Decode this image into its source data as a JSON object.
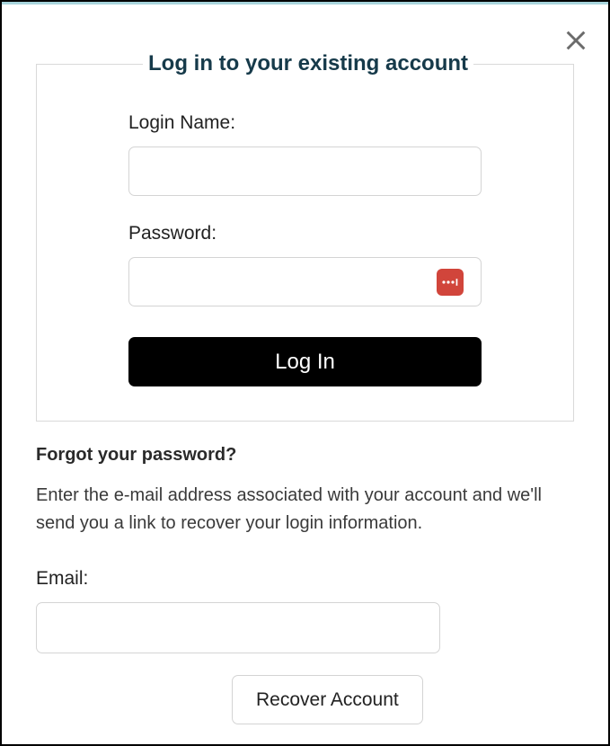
{
  "login": {
    "legend": "Log in to your existing account",
    "login_name_label": "Login Name:",
    "password_label": "Password:",
    "login_name_value": "",
    "password_value": "",
    "submit_label": "Log In"
  },
  "forgot": {
    "title": "Forgot your password?",
    "description": "Enter the e-mail address associated with your account and we'll send you a link to recover your login information.",
    "email_label": "Email:",
    "email_value": "",
    "recover_label": "Recover Account"
  }
}
